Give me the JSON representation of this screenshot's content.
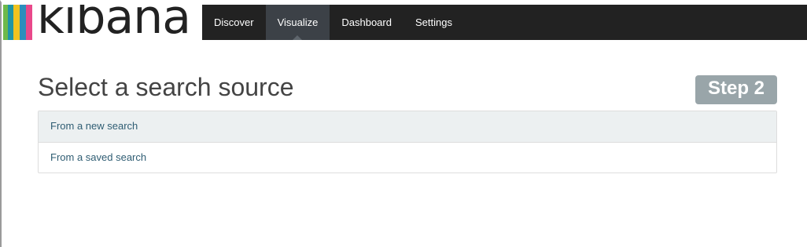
{
  "app": {
    "logo_text": "kibana",
    "stripe_colors": [
      "#6eb94a",
      "#1f95a6",
      "#f0c320",
      "#2d8ebc",
      "#e9488a"
    ]
  },
  "nav": {
    "items": [
      {
        "label": "Discover",
        "active": false
      },
      {
        "label": "Visualize",
        "active": true
      },
      {
        "label": "Dashboard",
        "active": false
      },
      {
        "label": "Settings",
        "active": false
      }
    ]
  },
  "main": {
    "title": "Select a search source",
    "step_badge": "Step 2",
    "sources": [
      {
        "label": "From a new search",
        "highlighted": true
      },
      {
        "label": "From a saved search",
        "highlighted": false
      }
    ]
  },
  "colors": {
    "navbar_bg": "#222222",
    "active_nav_bg": "#3c4147",
    "badge_bg": "#99a5a9",
    "link_color": "#2f5d73",
    "highlight_row_bg": "#ecf0f1"
  }
}
